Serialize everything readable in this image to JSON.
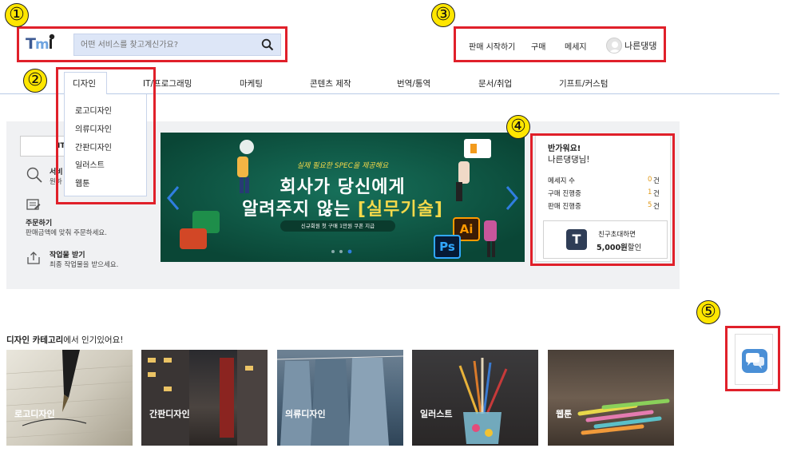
{
  "header": {
    "logo_text": "TMi",
    "search_placeholder": "어떤 서비스를 찾고계신가요?",
    "nav": [
      "판매 시작하기",
      "구매",
      "메세지"
    ],
    "username": "나른댕댕"
  },
  "categories": [
    "디자인",
    "IT/프로그래밍",
    "마케팅",
    "콘텐츠 제작",
    "번역/통역",
    "문서/취업",
    "기프트/커스텀"
  ],
  "dropdown": [
    "로고디자인",
    "의류디자인",
    "간판디자인",
    "일러스트",
    "웹툰"
  ],
  "side": {
    "input_partial": "IT",
    "search_title_partial": "서비",
    "search_desc_partial": "원하",
    "order_title": "주문하기",
    "order_desc": "판매금액에 맞춰 주문하세요.",
    "receive_title": "작업물 받기",
    "receive_desc": "최종 작업물을 받으세요."
  },
  "banner": {
    "script_text": "실제 필요한 SPEC을 제공해요",
    "headline1": "회사가 당신에게",
    "headline2_prefix": "알려주지 않는",
    "headline2_highlight": "[실무기술]",
    "pill": "신규회원 첫 구매 1만원 쿠폰 지급",
    "ai_icon": "Ai",
    "ps_icon": "Ps",
    "colors": {
      "bg": "#0f5a45",
      "highlight": "#f5d94a"
    }
  },
  "card": {
    "greeting": "반가워요!",
    "name": "나른댕댕님!",
    "stats": [
      {
        "label": "메세지 수",
        "value": "0",
        "unit": "건"
      },
      {
        "label": "구매 진행중",
        "value": "1",
        "unit": "건"
      },
      {
        "label": "판매 진행중",
        "value": "5",
        "unit": "건"
      }
    ],
    "promo_icon": "T",
    "promo_line1": "친구초대하면",
    "promo_amount": "5,000원",
    "promo_suffix": "할인"
  },
  "section": {
    "title_bold": "디자인 카테고리",
    "title_rest": "에서 인기있어요!",
    "tiles": [
      "로고디자인",
      "간판디자인",
      "의류디자인",
      "일러스트",
      "웹툰"
    ]
  },
  "callouts": [
    "①",
    "②",
    "③",
    "④",
    "⑤"
  ],
  "colors": {
    "accent_red": "#e0202a",
    "callout_yellow": "#ffe600",
    "stat_orange": "#e09a1a"
  }
}
